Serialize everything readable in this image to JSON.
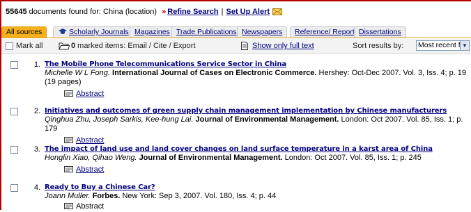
{
  "summary": {
    "count": "55645",
    "text": " documents found for: China (location) ",
    "arrow": "»",
    "refine": "Refine Search",
    "separator": "|",
    "alert": "Set Up Alert"
  },
  "tabs": [
    {
      "label": "All sources"
    },
    {
      "label": "Scholarly Journals"
    },
    {
      "label": "Magazines"
    },
    {
      "label": "Trade Publications"
    },
    {
      "label": "Newspapers"
    },
    {
      "label": "Reference/ Reports"
    },
    {
      "label": "Dissertations"
    }
  ],
  "toolbar": {
    "mark_all": "Mark all",
    "marked_count": "0",
    "marked_text": " marked items: Email / Cite / Export",
    "full_text": "Show only full text",
    "sort_label": "Sort results by:",
    "sort_value": "Most recent first"
  },
  "results": [
    {
      "num": "1.",
      "title": "The Mobile Phone Telecommunications Service Sector in China",
      "authors": "Michelle W L Fong.",
      "journal": "International Journal of Cases on Electronic Commerce.",
      "details": " Hershey: Oct-Dec 2007. Vol. 3, Iss. 4; p. 19 (19 pages)",
      "abstract": "Abstract"
    },
    {
      "num": "2.",
      "title": "Initiatives and outcomes of green supply chain management implementation by Chinese manufacturers",
      "authors": "Qinghua Zhu, Joseph Sarkis, Kee-hung Lai.",
      "journal": "Journal of Environmental Management.",
      "details": " London: Oct 2007. Vol. 85, Iss. 1; p. 179",
      "abstract": "Abstract"
    },
    {
      "num": "3.",
      "title": "The impact of land use and land cover changes on land surface temperature in a karst area of China",
      "authors": "Honglin Xiao, Qihao Weng.",
      "journal": "Journal of Environmental Management.",
      "details": " London: Oct 2007. Vol. 85, Iss. 1; p. 245",
      "abstract": "Abstract"
    },
    {
      "num": "4.",
      "title": "Ready to Buy a Chinese Car?",
      "authors": "Joann Muller.",
      "journal": "Forbes.",
      "details": " New York: Sep 3, 2007. Vol. 180, Iss. 4; p. 44",
      "abstract": "Abstract"
    }
  ],
  "colors": {
    "frame": "#b40000",
    "link": "#000080",
    "active_tab": "#f5b01d"
  },
  "icons": [
    "envelope-icon",
    "graduation-cap-icon",
    "folder-icon",
    "document-icon",
    "abstract-icon",
    "chevron-down-icon"
  ]
}
